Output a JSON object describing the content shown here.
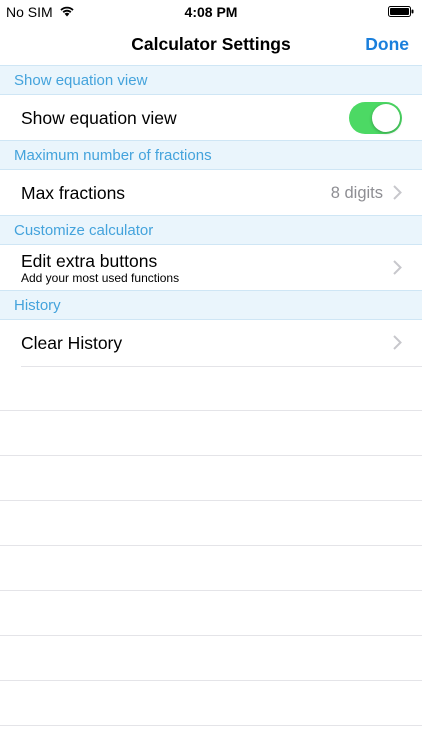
{
  "status_bar": {
    "carrier": "No SIM",
    "time": "4:08 PM",
    "wifi_icon": "wifi-icon",
    "battery_icon": "battery-icon"
  },
  "nav": {
    "title": "Calculator Settings",
    "done_label": "Done"
  },
  "sections": [
    {
      "header": "Show equation view",
      "rows": [
        {
          "title": "Show equation view",
          "toggle_on": true
        }
      ]
    },
    {
      "header": "Maximum number of fractions",
      "rows": [
        {
          "title": "Max fractions",
          "detail": "8 digits"
        }
      ]
    },
    {
      "header": "Customize calculator",
      "rows": [
        {
          "title": "Edit extra buttons",
          "subtitle": "Add your most used functions"
        }
      ]
    },
    {
      "header": "History",
      "rows": [
        {
          "title": "Clear History"
        }
      ]
    }
  ],
  "colors": {
    "accent": "#1a7fdc",
    "section_header_bg": "#eaf5fc",
    "section_header_text": "#44a3dc",
    "toggle_on": "#4cd964"
  }
}
